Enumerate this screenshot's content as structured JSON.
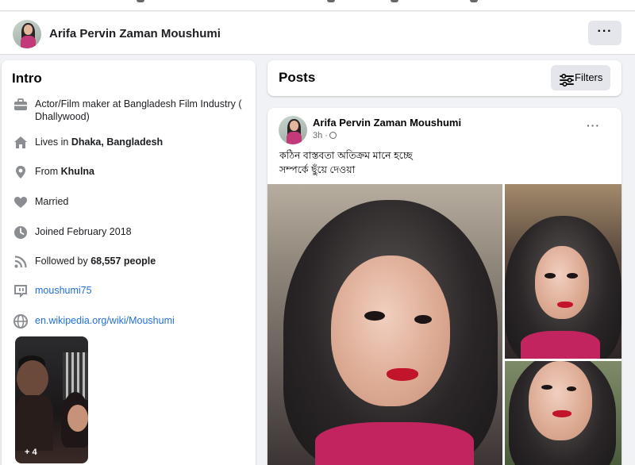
{
  "profile": {
    "name": "Arifa Pervin Zaman Moushumi",
    "more_label": "···"
  },
  "intro": {
    "title": "Intro",
    "items": [
      {
        "icon": "briefcase-icon",
        "text": "Actor/Film maker at Bangladesh Film Industry ( Dhallywood)"
      },
      {
        "icon": "home-icon",
        "prefix": "Lives in ",
        "bold": "Dhaka, Bangladesh"
      },
      {
        "icon": "location-pin-icon",
        "prefix": "From ",
        "bold": "Khulna"
      },
      {
        "icon": "heart-icon",
        "text": "Married"
      },
      {
        "icon": "clock-icon",
        "text": "Joined February 2018"
      },
      {
        "icon": "rss-icon",
        "prefix": "Followed by ",
        "bold": "68,557 people"
      },
      {
        "icon": "twitch-icon",
        "link": "moushumi75"
      },
      {
        "icon": "globe-icon",
        "link": "en.wikipedia.org/wiki/Moushumi"
      }
    ],
    "photo_more": "+ 4"
  },
  "posts": {
    "title": "Posts",
    "filters_label": "Filters"
  },
  "post": {
    "author": "Arifa Pervin Zaman Moushumi",
    "time": "3h ·",
    "more_label": "···",
    "text_line1": "কঠিন বাস্তবতা অতিক্রম মানে হচ্ছে",
    "text_line2": "সম্পর্কে ছুঁয়ে দেওয়া"
  },
  "colors": {
    "background": "#f0f2f5",
    "card": "#ffffff",
    "link": "#216fdb",
    "icon": "#65676b",
    "button": "#e4e6eb"
  }
}
